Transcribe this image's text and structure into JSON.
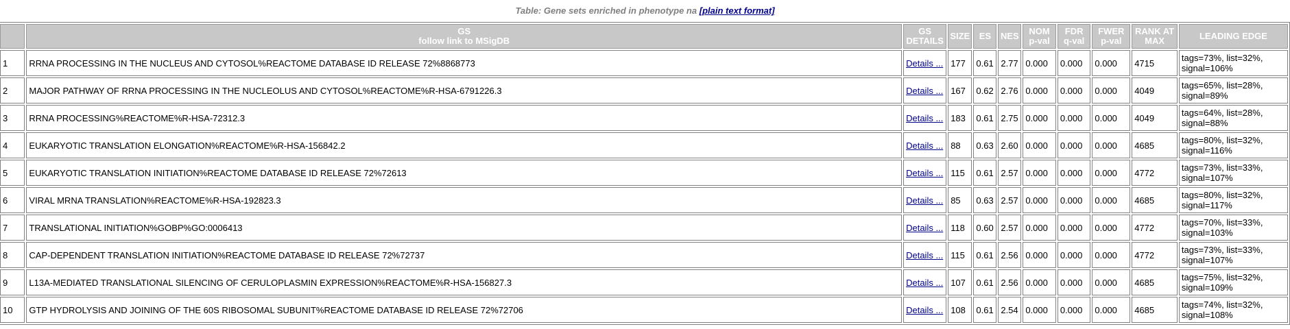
{
  "caption": {
    "text": "Table: Gene sets enriched in phenotype na",
    "link": "[plain text format]"
  },
  "headers": {
    "index": "",
    "gs_line1": "GS",
    "gs_line2": "follow link to MSigDB",
    "details_line1": "GS",
    "details_line2": "DETAILS",
    "size": "SIZE",
    "es": "ES",
    "nes": "NES",
    "nom_line1": "NOM",
    "nom_line2": "p-val",
    "fdr_line1": "FDR",
    "fdr_line2": "q-val",
    "fwer_line1": "FWER",
    "fwer_line2": "p-val",
    "rank_line1": "RANK AT",
    "rank_line2": "MAX",
    "leading_edge": "LEADING EDGE"
  },
  "rows": [
    {
      "idx": "1",
      "name": "RRNA PROCESSING IN THE NUCLEUS AND CYTOSOL%REACTOME DATABASE ID RELEASE 72%8868773",
      "details": "Details ...",
      "size": "177",
      "es": "0.61",
      "nes": "2.77",
      "nom": "0.000",
      "fdr": "0.000",
      "fwer": "0.000",
      "rank": "4715",
      "leading": "tags=73%, list=32%, signal=106%"
    },
    {
      "idx": "2",
      "name": "MAJOR PATHWAY OF RRNA PROCESSING IN THE NUCLEOLUS AND CYTOSOL%REACTOME%R-HSA-6791226.3",
      "details": "Details ...",
      "size": "167",
      "es": "0.62",
      "nes": "2.76",
      "nom": "0.000",
      "fdr": "0.000",
      "fwer": "0.000",
      "rank": "4049",
      "leading": "tags=65%, list=28%, signal=89%"
    },
    {
      "idx": "3",
      "name": "RRNA PROCESSING%REACTOME%R-HSA-72312.3",
      "details": "Details ...",
      "size": "183",
      "es": "0.61",
      "nes": "2.75",
      "nom": "0.000",
      "fdr": "0.000",
      "fwer": "0.000",
      "rank": "4049",
      "leading": "tags=64%, list=28%, signal=88%"
    },
    {
      "idx": "4",
      "name": "EUKARYOTIC TRANSLATION ELONGATION%REACTOME%R-HSA-156842.2",
      "details": "Details ...",
      "size": "88",
      "es": "0.63",
      "nes": "2.60",
      "nom": "0.000",
      "fdr": "0.000",
      "fwer": "0.000",
      "rank": "4685",
      "leading": "tags=80%, list=32%, signal=116%"
    },
    {
      "idx": "5",
      "name": "EUKARYOTIC TRANSLATION INITIATION%REACTOME DATABASE ID RELEASE 72%72613",
      "details": "Details ...",
      "size": "115",
      "es": "0.61",
      "nes": "2.57",
      "nom": "0.000",
      "fdr": "0.000",
      "fwer": "0.000",
      "rank": "4772",
      "leading": "tags=73%, list=33%, signal=107%"
    },
    {
      "idx": "6",
      "name": "VIRAL MRNA TRANSLATION%REACTOME%R-HSA-192823.3",
      "details": "Details ...",
      "size": "85",
      "es": "0.63",
      "nes": "2.57",
      "nom": "0.000",
      "fdr": "0.000",
      "fwer": "0.000",
      "rank": "4685",
      "leading": "tags=80%, list=32%, signal=117%"
    },
    {
      "idx": "7",
      "name": "TRANSLATIONAL INITIATION%GOBP%GO:0006413",
      "details": "Details ...",
      "size": "118",
      "es": "0.60",
      "nes": "2.57",
      "nom": "0.000",
      "fdr": "0.000",
      "fwer": "0.000",
      "rank": "4772",
      "leading": "tags=70%, list=33%, signal=103%"
    },
    {
      "idx": "8",
      "name": "CAP-DEPENDENT TRANSLATION INITIATION%REACTOME DATABASE ID RELEASE 72%72737",
      "details": "Details ...",
      "size": "115",
      "es": "0.61",
      "nes": "2.56",
      "nom": "0.000",
      "fdr": "0.000",
      "fwer": "0.000",
      "rank": "4772",
      "leading": "tags=73%, list=33%, signal=107%"
    },
    {
      "idx": "9",
      "name": "L13A-MEDIATED TRANSLATIONAL SILENCING OF CERULOPLASMIN EXPRESSION%REACTOME%R-HSA-156827.3",
      "details": "Details ...",
      "size": "107",
      "es": "0.61",
      "nes": "2.56",
      "nom": "0.000",
      "fdr": "0.000",
      "fwer": "0.000",
      "rank": "4685",
      "leading": "tags=75%, list=32%, signal=109%"
    },
    {
      "idx": "10",
      "name": "GTP HYDROLYSIS AND JOINING OF THE 60S RIBOSOMAL SUBUNIT%REACTOME DATABASE ID RELEASE 72%72706",
      "details": "Details ...",
      "size": "108",
      "es": "0.61",
      "nes": "2.54",
      "nom": "0.000",
      "fdr": "0.000",
      "fwer": "0.000",
      "rank": "4685",
      "leading": "tags=74%, list=32%, signal=108%"
    }
  ]
}
